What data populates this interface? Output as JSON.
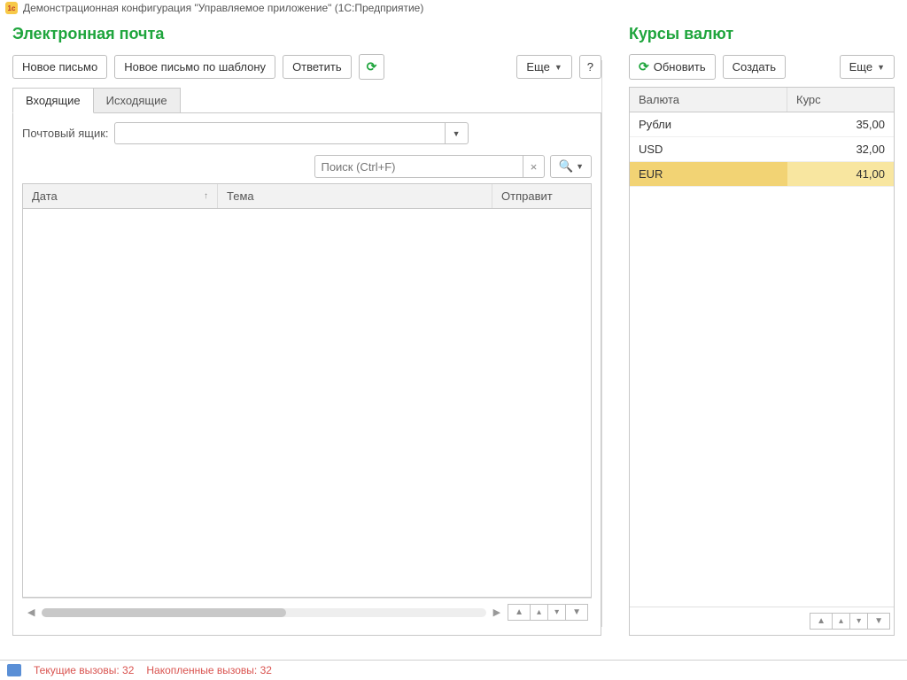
{
  "titlebar": {
    "text": "Демонстрационная конфигурация \"Управляемое приложение\"  (1С:Предприятие)"
  },
  "email": {
    "title": "Электронная почта",
    "buttons": {
      "new": "Новое письмо",
      "new_template": "Новое письмо по шаблону",
      "reply": "Ответить",
      "more": "Еще",
      "help": "?"
    },
    "tabs": {
      "inbox": "Входящие",
      "outbox": "Исходящие"
    },
    "mailbox_label": "Почтовый ящик:",
    "search_placeholder": "Поиск (Ctrl+F)",
    "columns": {
      "date": "Дата",
      "subject": "Тема",
      "sender": "Отправит"
    }
  },
  "rates": {
    "title": "Курсы валют",
    "buttons": {
      "refresh": "Обновить",
      "create": "Создать",
      "more": "Еще"
    },
    "columns": {
      "currency": "Валюта",
      "rate": "Курс"
    },
    "rows": [
      {
        "currency": "Рубли",
        "rate": "35,00"
      },
      {
        "currency": "USD",
        "rate": "32,00"
      },
      {
        "currency": "EUR",
        "rate": "41,00"
      }
    ]
  },
  "status": {
    "current_label": "Текущие вызовы:",
    "current_value": "32",
    "accum_label": "Накопленные вызовы:",
    "accum_value": "32"
  }
}
